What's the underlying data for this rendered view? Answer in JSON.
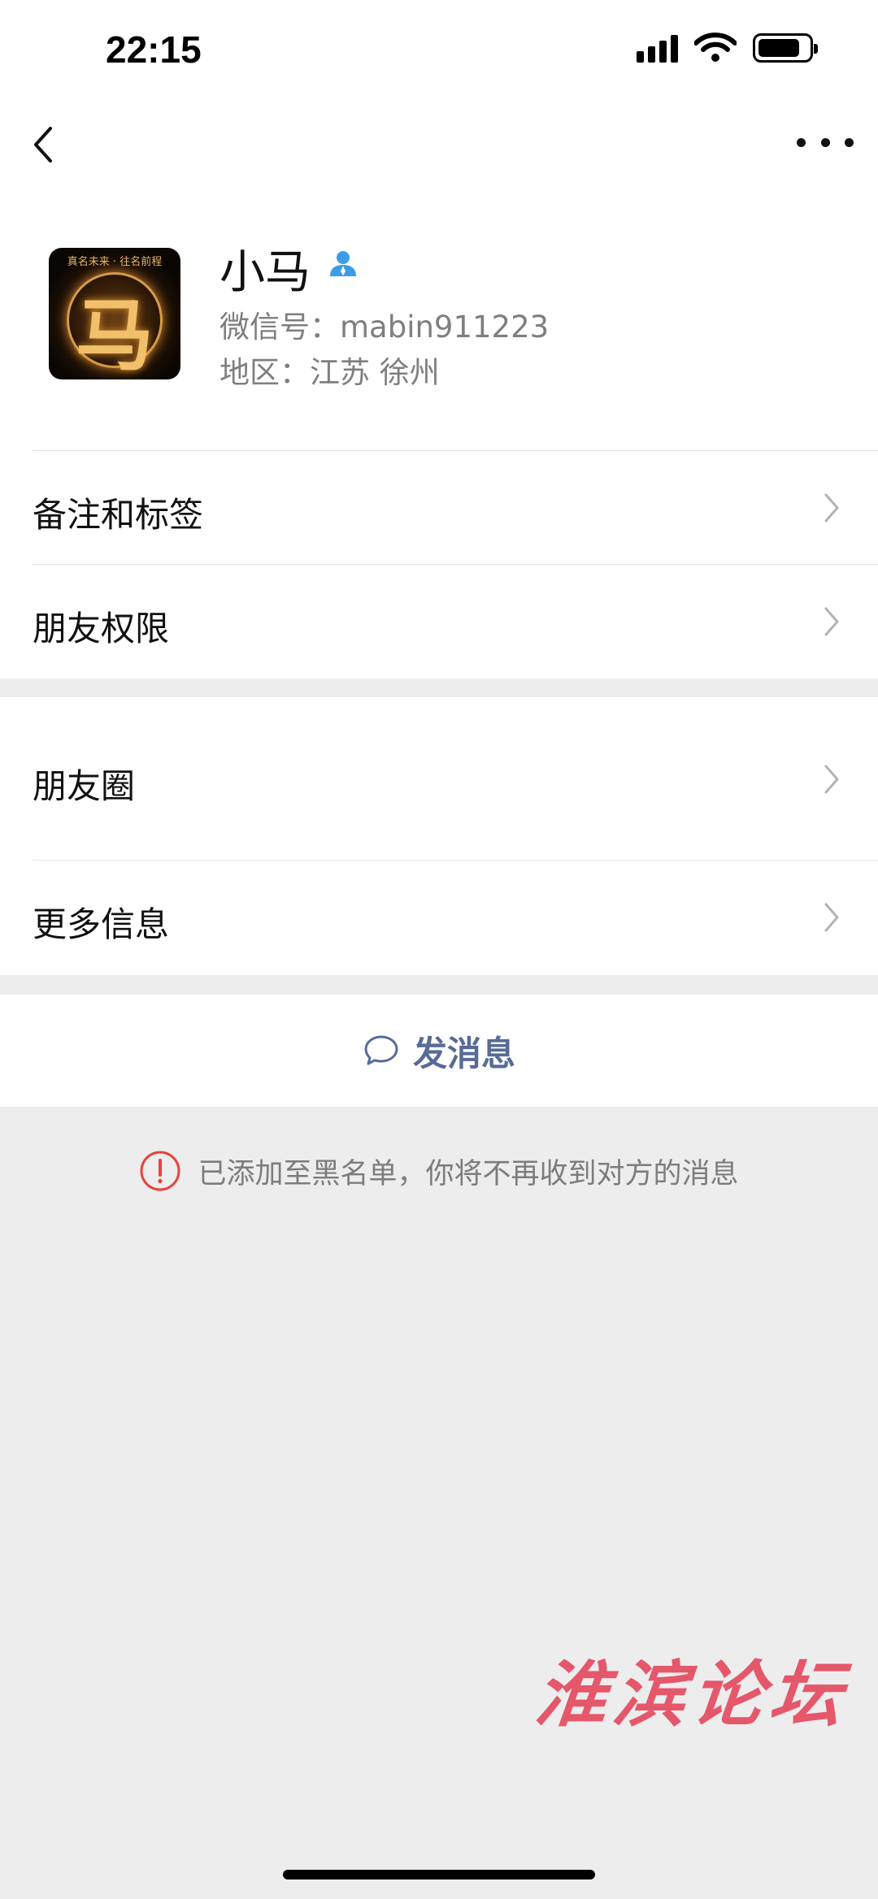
{
  "status_bar": {
    "time": "22:15"
  },
  "profile": {
    "name": "小马",
    "wechat_id": "微信号：mabin911223",
    "region": "地区：江苏 徐州",
    "avatar_char": "马",
    "avatar_caption": "真名未来 · 往名前程"
  },
  "menu_group_1": [
    {
      "label": "备注和标签",
      "icon": "chevron-right-icon"
    },
    {
      "label": "朋友权限",
      "icon": "chevron-right-icon"
    }
  ],
  "menu_group_2": [
    {
      "label": "朋友圈",
      "icon": "chevron-right-icon"
    },
    {
      "label": "更多信息",
      "icon": "chevron-right-icon"
    }
  ],
  "send_message": {
    "label": "发消息",
    "icon": "chat-bubble-icon"
  },
  "blacklist_notice": {
    "text": "已添加至黑名单，你将不再收到对方的消息",
    "icon": "alert-circle-icon"
  },
  "watermark": "淮滨论坛",
  "colors": {
    "background": "#ededed",
    "card": "#ffffff",
    "link": "#576b95",
    "warning": "#e64340",
    "secondary_text": "#7f7f7f",
    "verify_blue": "#3a9de8",
    "watermark": "#e5576a"
  }
}
